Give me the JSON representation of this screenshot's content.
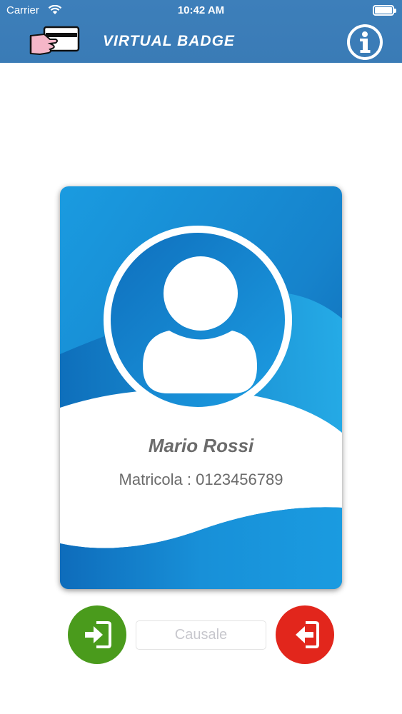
{
  "status_bar": {
    "carrier": "Carrier",
    "time": "10:42 AM",
    "icons": [
      "wifi-icon",
      "battery-icon"
    ]
  },
  "header": {
    "title": "VIRTUAL BADGE",
    "logo_icon": "hand-card-icon",
    "info_icon": "info-icon",
    "background_color": "#3c7db8"
  },
  "badge": {
    "name": "Mario Rossi",
    "matricola": "Matricola : 0123456789",
    "avatar_icon": "user-silhouette-icon",
    "accent_color": "#1e8fd6"
  },
  "actions": {
    "check_in_icon": "enter-icon",
    "check_in_color": "#4a9b1c",
    "reason_placeholder": "Causale",
    "check_out_icon": "exit-icon",
    "check_out_color": "#e2261c"
  }
}
